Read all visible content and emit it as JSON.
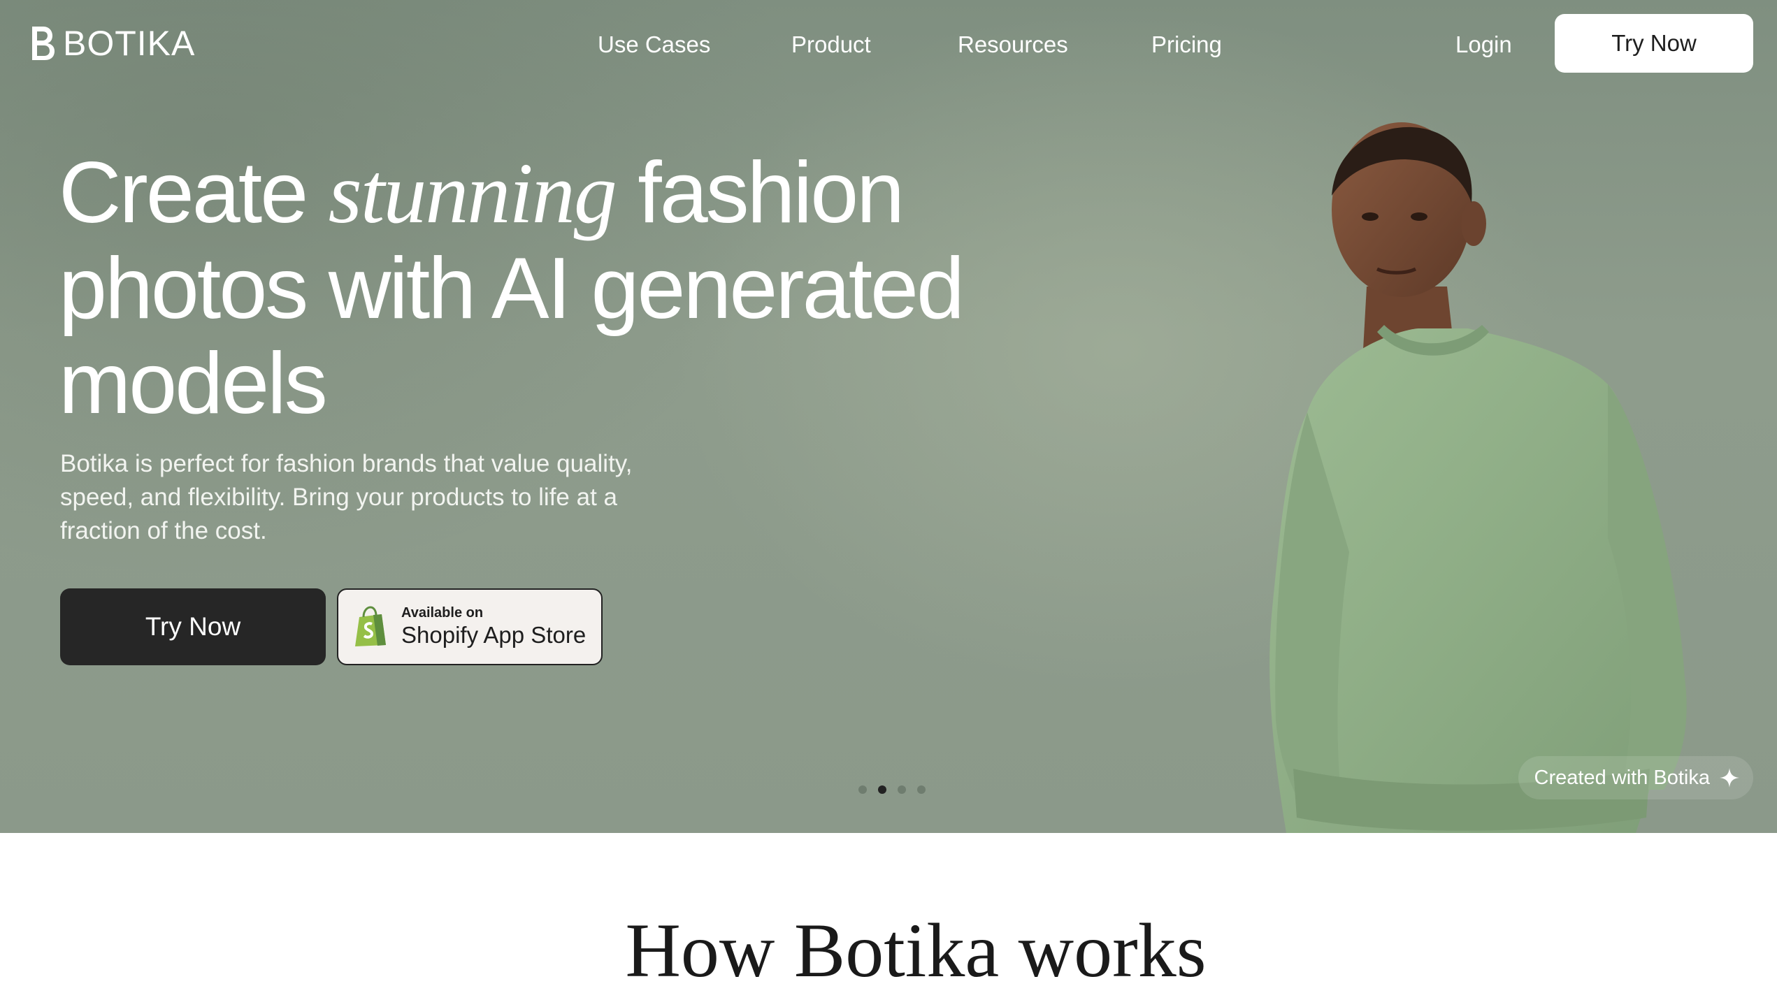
{
  "brand": {
    "name": "BOTIKA"
  },
  "nav": {
    "items": [
      "Use Cases",
      "Product",
      "Resources",
      "Pricing"
    ],
    "login": "Login",
    "cta": "Try Now"
  },
  "hero": {
    "headline_pre": "Create ",
    "headline_em": "stunning",
    "headline_post": " fashion photos with AI generated models",
    "subtext": "Botika is perfect for fashion brands that value quality, speed, and flexibility. Bring your products to life at a fraction of the cost.",
    "cta_primary": "Try Now",
    "shopify_small": "Available on",
    "shopify_big": "Shopify App Store",
    "carousel_active_index": 1,
    "carousel_count": 4,
    "created_badge": "Created with Botika"
  },
  "colors": {
    "hero_bg": "#8b998a",
    "sweater": "#8fae86",
    "primary_button": "#262626"
  },
  "next_section": {
    "heading": "How Botika works"
  }
}
